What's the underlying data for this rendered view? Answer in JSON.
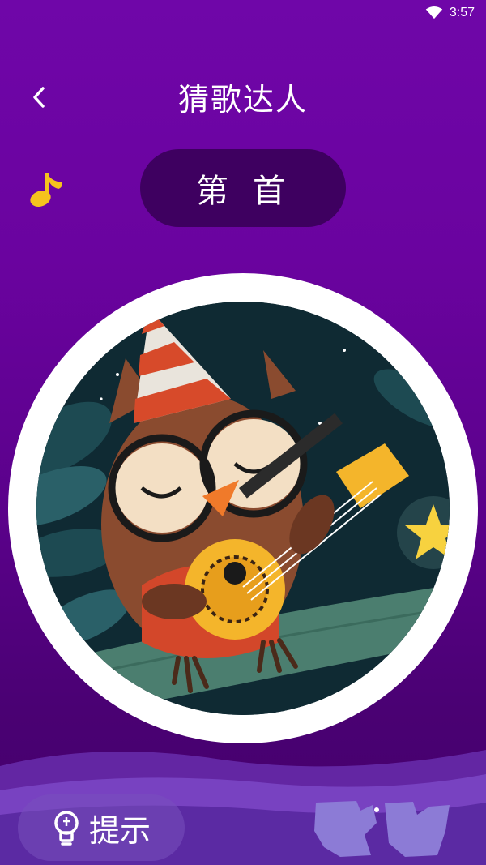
{
  "status_bar": {
    "time": "3:57"
  },
  "header": {
    "title": "猜歌达人"
  },
  "round": {
    "prefix": "第",
    "number": "",
    "suffix": "首"
  },
  "hint": {
    "label": "提示"
  },
  "colors": {
    "background_top": "#6f06a8",
    "background_bottom": "#43006b",
    "pill": "#3e0060",
    "note": "#f5c31d",
    "disc_ring": "#ffffff"
  },
  "icons": {
    "back": "chevron-left-icon",
    "music": "music-note-icon",
    "hint": "lightbulb-icon",
    "wifi": "wifi-icon"
  }
}
